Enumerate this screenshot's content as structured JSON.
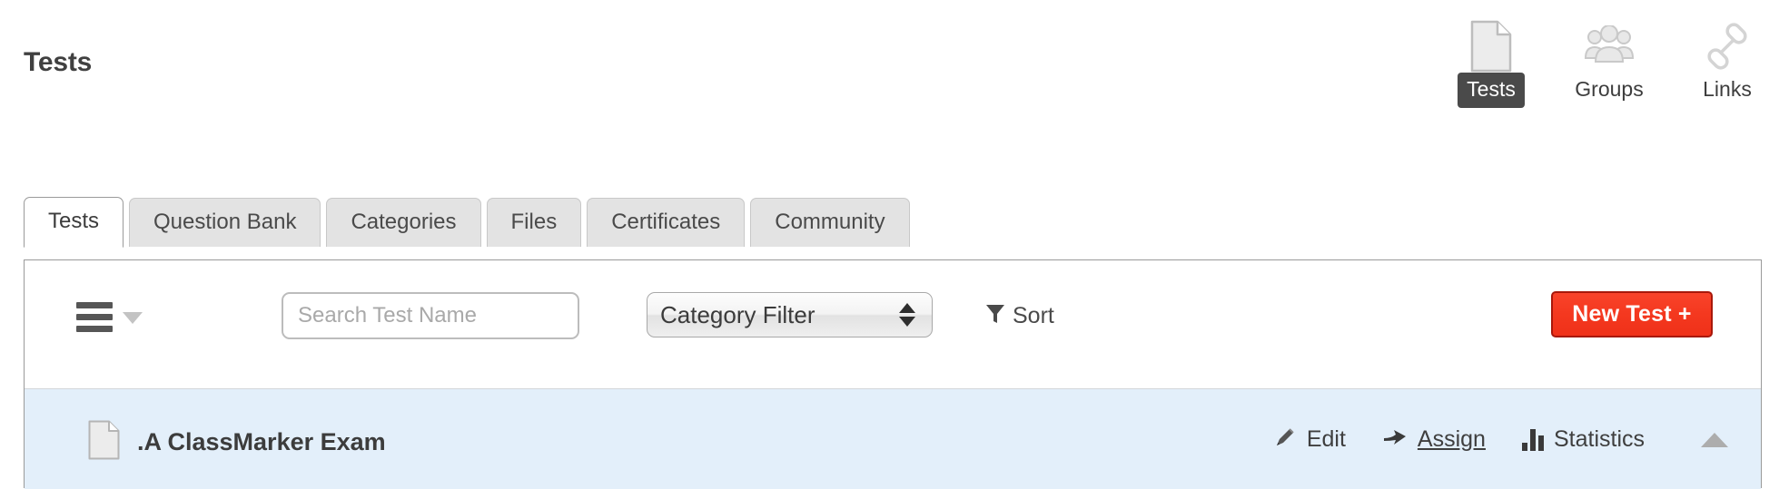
{
  "header": {
    "title": "Tests",
    "nav_items": [
      {
        "label": "Tests",
        "icon": "document-icon",
        "active": true
      },
      {
        "label": "Groups",
        "icon": "groups-icon",
        "active": false
      },
      {
        "label": "Links",
        "icon": "link-icon",
        "active": false
      }
    ]
  },
  "tabs": [
    {
      "label": "Tests",
      "active": true
    },
    {
      "label": "Question Bank",
      "active": false
    },
    {
      "label": "Categories",
      "active": false
    },
    {
      "label": "Files",
      "active": false
    },
    {
      "label": "Certificates",
      "active": false
    },
    {
      "label": "Community",
      "active": false
    }
  ],
  "toolbar": {
    "menu_icon": "hamburger-icon",
    "menu_caret_icon": "chevron-down-icon",
    "search": {
      "value": "",
      "placeholder": "Search Test Name"
    },
    "category_filter": {
      "selected": "Category Filter",
      "stepper_icon": "updown-arrows-icon"
    },
    "sort": {
      "label": "Sort",
      "icon": "filter-funnel-icon"
    },
    "new_test": {
      "label": "New Test +",
      "color": "#f4381f",
      "border_color": "#a8180b",
      "text_color": "#ffffff"
    }
  },
  "tests": [
    {
      "name": ".A ClassMarker Exam",
      "icon": "document-icon",
      "highlight_color": "#e3effa",
      "actions": [
        {
          "label": "Edit",
          "icon": "pencil-icon",
          "underlined": false
        },
        {
          "label": "Assign",
          "icon": "arrow-right-icon",
          "underlined": true
        },
        {
          "label": "Statistics",
          "icon": "bar-chart-icon",
          "underlined": false
        }
      ],
      "collapse_icon": "triangle-up-icon"
    }
  ]
}
